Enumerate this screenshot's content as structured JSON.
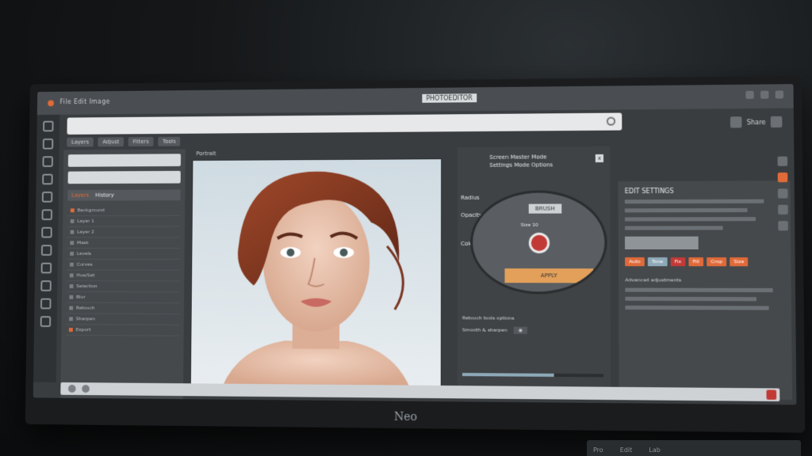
{
  "window": {
    "menu": "File   Edit   Image",
    "title": "PHOTOEDITOR"
  },
  "urlbar": {
    "text": ""
  },
  "tabs": [
    "Layers",
    "Adjust",
    "Filters",
    "Tools"
  ],
  "top_right": {
    "label": "Share"
  },
  "left_panel": {
    "search_placeholder": "",
    "heading_a": "Layers",
    "heading_b": "History",
    "items": [
      "Background",
      "Layer 1",
      "Layer 2",
      "Mask",
      "Levels",
      "Curves",
      "Hue/Sat",
      "Selection",
      "Blur",
      "Retouch",
      "Sharpen",
      "Export"
    ]
  },
  "canvas": {
    "label": "Portrait"
  },
  "dialog": {
    "title_line1": "Screen Master Mode",
    "title_line2": "Settings Mode Options",
    "close": "x",
    "badge": "BRUSH",
    "label": "Size 10",
    "bar": "APPLY",
    "side_a": "Radius",
    "side_b": "Opacity",
    "side_c": "Color",
    "foot_1": "Retouch tools options",
    "foot_2": "Smooth & sharpen",
    "progress": 0.65
  },
  "right_panel": {
    "title": "EDIT SETTINGS",
    "section": "Advanced adjustments",
    "buttons": [
      {
        "label": "Auto",
        "color": "#e06a3a"
      },
      {
        "label": "Tone",
        "color": "#8ea9b8"
      },
      {
        "label": "Fix",
        "color": "#c23a36"
      },
      {
        "label": "Fill",
        "color": "#e06a3a"
      },
      {
        "label": "Crop",
        "color": "#e06a3a"
      },
      {
        "label": "Size",
        "color": "#e06a3a"
      }
    ]
  },
  "monitor": {
    "brand": "Neo"
  },
  "stand": {
    "labels": [
      "Pro",
      "Edit",
      "Lab"
    ]
  }
}
